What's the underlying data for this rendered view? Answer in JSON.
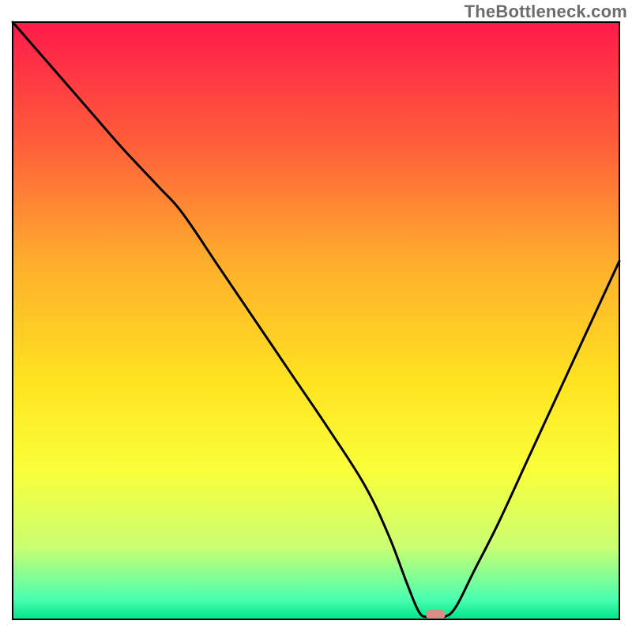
{
  "watermark": "TheBottleneck.com",
  "chart_data": {
    "type": "line",
    "title": "",
    "xlabel": "",
    "ylabel": "",
    "xlim": [
      0,
      100
    ],
    "ylim": [
      0,
      100
    ],
    "grid": false,
    "legend": false,
    "background": {
      "type": "vertical-gradient",
      "stops": [
        {
          "offset": 0.0,
          "color": "#ff1a4b"
        },
        {
          "offset": 0.2,
          "color": "#ff5d3a"
        },
        {
          "offset": 0.4,
          "color": "#ffad2d"
        },
        {
          "offset": 0.6,
          "color": "#ffe320"
        },
        {
          "offset": 0.75,
          "color": "#faff3a"
        },
        {
          "offset": 0.88,
          "color": "#c9ff72"
        },
        {
          "offset": 0.965,
          "color": "#4dffb0"
        },
        {
          "offset": 1.0,
          "color": "#00e48a"
        }
      ]
    },
    "series": [
      {
        "name": "bottleneck-curve",
        "color": "#000000",
        "x": [
          0.0,
          6.0,
          12.0,
          18.0,
          24.0,
          28.0,
          34.0,
          40.0,
          46.0,
          52.0,
          58.0,
          62.0,
          65.0,
          67.0,
          68.5,
          71.0,
          73.0,
          76.0,
          80.0,
          85.0,
          90.0,
          95.0,
          100.0
        ],
        "y": [
          100.0,
          93.0,
          86.0,
          79.0,
          72.5,
          68.0,
          59.0,
          50.0,
          41.0,
          32.0,
          22.5,
          14.0,
          6.0,
          1.2,
          0.4,
          0.4,
          2.0,
          8.0,
          16.0,
          27.0,
          38.0,
          49.0,
          60.0
        ]
      }
    ],
    "marker": {
      "name": "optimum-pill",
      "x": 69.7,
      "y": 0.8,
      "width_pct": 3.2,
      "height_pct": 1.6,
      "color": "#d98d87"
    }
  }
}
